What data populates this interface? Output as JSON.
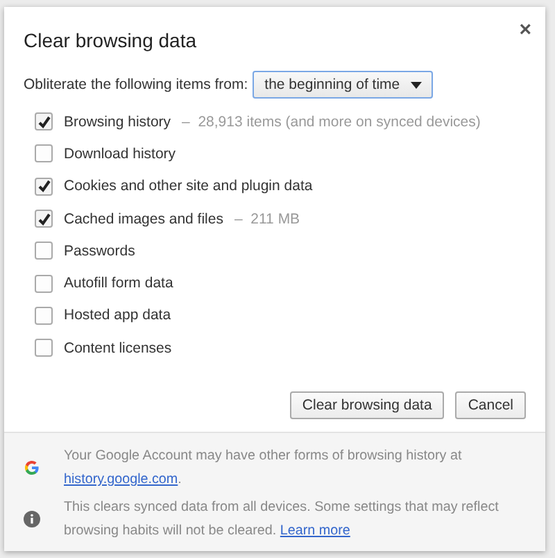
{
  "dialog": {
    "title": "Clear browsing data",
    "close": "×"
  },
  "range": {
    "label": "Obliterate the following items from:",
    "value": "the beginning of time"
  },
  "items": [
    {
      "label": "Browsing history",
      "detail": "–  28,913 items (and more on synced devices)",
      "checked": true
    },
    {
      "label": "Download history",
      "checked": false
    },
    {
      "label": "Cookies and other site and plugin data",
      "checked": true
    },
    {
      "label": "Cached images and files",
      "detail": "–  211 MB",
      "checked": true
    },
    {
      "label": "Passwords",
      "checked": false
    },
    {
      "label": "Autofill form data",
      "checked": false
    },
    {
      "label": "Hosted app data",
      "checked": false
    },
    {
      "label": "Content licenses",
      "checked": false
    }
  ],
  "buttons": [
    "Clear browsing data",
    "Cancel"
  ],
  "notes": [
    {
      "kind": "google",
      "text": "Your Google Account may have other forms of browsing history at",
      "link": "history.google.com",
      "after": "."
    },
    {
      "kind": "info",
      "text": "This clears synced data from all devices. Some settings that may reflect browsing habits will not be cleared.",
      "link": "Learn more"
    }
  ]
}
